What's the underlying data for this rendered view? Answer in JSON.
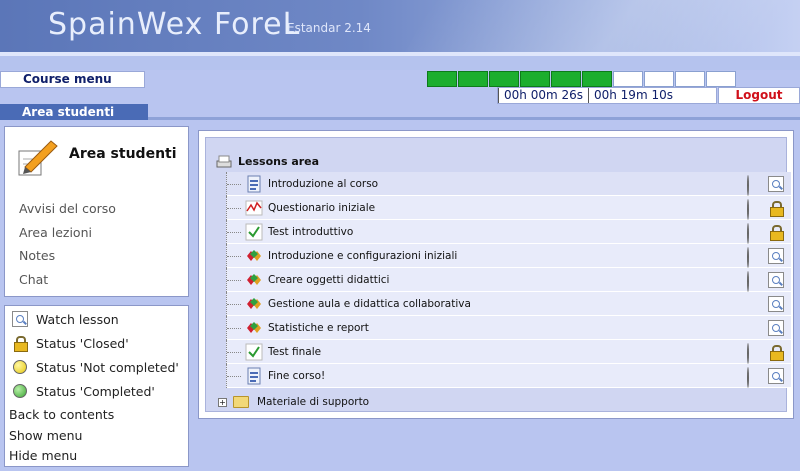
{
  "header": {
    "brand": "SpainWex ForeL",
    "version": "Estandar 2.14"
  },
  "menubar": {
    "course_menu": "Course menu",
    "progress": {
      "filled": 6,
      "total": 10
    },
    "elapsed": "00h 00m 26s",
    "remaining": "00h 19m 10s",
    "logout": "Logout"
  },
  "area_tab": "Area studenti",
  "left_panel": {
    "title": "Area studenti",
    "nav": [
      "Avvisi del corso",
      "Area lezioni",
      "Notes",
      "Chat"
    ]
  },
  "legend": {
    "watch": "Watch lesson",
    "closed": "Status 'Closed'",
    "not_completed": "Status 'Not completed'",
    "completed": "Status 'Completed'",
    "back": "Back to contents",
    "show": "Show menu",
    "hide": "Hide menu"
  },
  "lessons": {
    "title": "Lessons area",
    "rows": [
      {
        "label": "Introduzione al corso",
        "icon": "page-icon",
        "status": "completed",
        "action": "watch"
      },
      {
        "label": "Questionario iniziale",
        "icon": "chart-icon",
        "status": "completed",
        "action": "closed"
      },
      {
        "label": "Test introduttivo",
        "icon": "check-icon",
        "status": "completed",
        "action": "closed"
      },
      {
        "label": "Introduzione e configurazioni iniziali",
        "icon": "gems-icon",
        "status": "completed",
        "action": "watch"
      },
      {
        "label": "Creare oggetti didattici",
        "icon": "gems-icon",
        "status": "not_completed",
        "action": "watch"
      },
      {
        "label": "Gestione aula e didattica collaborativa",
        "icon": "gems-icon",
        "status": "none",
        "action": "watch"
      },
      {
        "label": "Statistiche e report",
        "icon": "gems-icon",
        "status": "none",
        "action": "watch"
      },
      {
        "label": "Test finale",
        "icon": "check-icon",
        "status": "completed",
        "action": "closed"
      },
      {
        "label": "Fine corso!",
        "icon": "page-icon",
        "status": "completed",
        "action": "watch"
      }
    ],
    "folder": "Materiale di supporto"
  },
  "colors": {
    "accent": "#4a6bb6",
    "background": "#b9c5f0",
    "progress_fill": "#1cae2e",
    "logout": "#d0101a"
  }
}
